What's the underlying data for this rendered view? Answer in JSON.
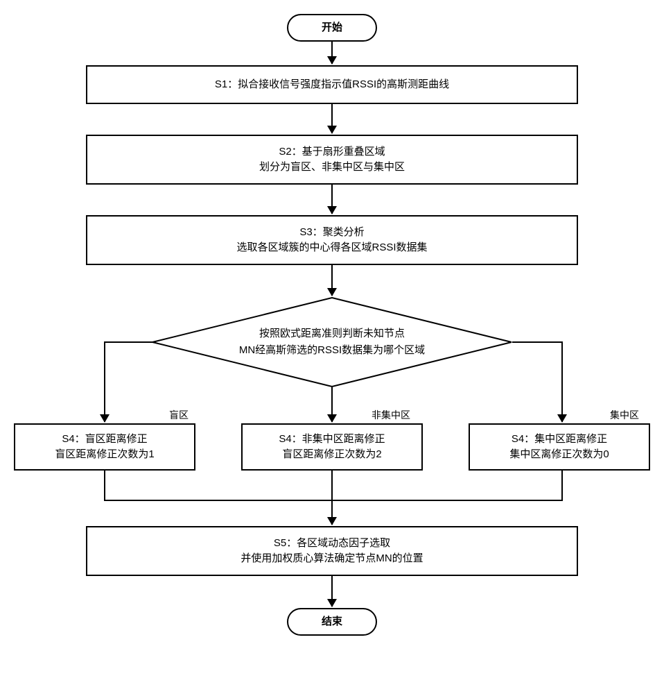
{
  "terminator": {
    "start": "开始",
    "end": "结束"
  },
  "steps": {
    "s1": "S1：拟合接收信号强度指示值RSSI的高斯测距曲线",
    "s2_l1": "S2：基于扇形重叠区域",
    "s2_l2": "划分为盲区、非集中区与集中区",
    "s3_l1": "S3：聚类分析",
    "s3_l2": "选取各区域簇的中心得各区域RSSI数据集",
    "s5_l1": "S5：各区域动态因子选取",
    "s5_l2": "并使用加权质心算法确定节点MN的位置"
  },
  "decision": {
    "l1": "按照欧式距离准则判断未知节点",
    "l2": "MN经高斯筛选的RSSI数据集为哪个区域"
  },
  "branches": {
    "blind": {
      "label": "盲区",
      "box_l1": "S4：盲区距离修正",
      "box_l2": "盲区距离修正次数为1"
    },
    "nonconc": {
      "label": "非集中区",
      "box_l1": "S4：非集中区距离修正",
      "box_l2": "盲区距离修正次数为2"
    },
    "conc": {
      "label": "集中区",
      "box_l1": "S4：集中区距离修正",
      "box_l2": "集中区离修正次数为0"
    }
  }
}
